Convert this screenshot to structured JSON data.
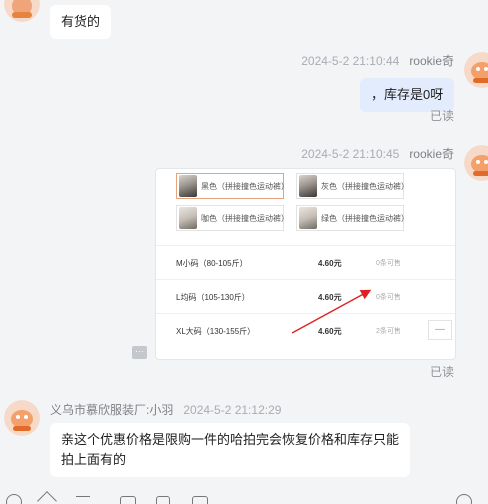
{
  "messages": {
    "first": {
      "text": "有货的"
    },
    "second": {
      "time": "2024-5-2 21:10:44",
      "sender": "rookie奇",
      "text": "，库存是0呀",
      "status": "已读"
    },
    "third": {
      "time": "2024-5-2 21:10:45",
      "sender": "rookie奇",
      "status": "已读"
    },
    "fourth": {
      "time": "2024-5-2 21:12:29",
      "sender": "义乌市慕欣服装厂:小羽",
      "text": "亲这个优惠价格是限购一件的哈拍完会恢复价格和库存只能拍上面有的"
    }
  },
  "product_card": {
    "variants": [
      {
        "label": "黑色（拼接撞色运动裤）"
      },
      {
        "label": "灰色（拼接撞色运动裤）"
      },
      {
        "label": "咖色（拼接撞色运动裤）"
      },
      {
        "label": "绿色（拼接撞色运动裤）"
      }
    ],
    "sizes": [
      {
        "name": "M小码（80-105斤）",
        "price": "4.60元",
        "stock": "0条可售"
      },
      {
        "name": "L均码（105-130斤）",
        "price": "4.60元",
        "stock": "0条可售"
      },
      {
        "name": "XL大码（130-155斤）",
        "price": "4.60元",
        "stock": "2条可售"
      }
    ],
    "qty_symbol": "—"
  },
  "colors": {
    "background": "#f3f4f6",
    "outgoing_bubble": "#e3ecfd",
    "incoming_bubble": "#ffffff",
    "annotation_arrow": "#e02020"
  }
}
